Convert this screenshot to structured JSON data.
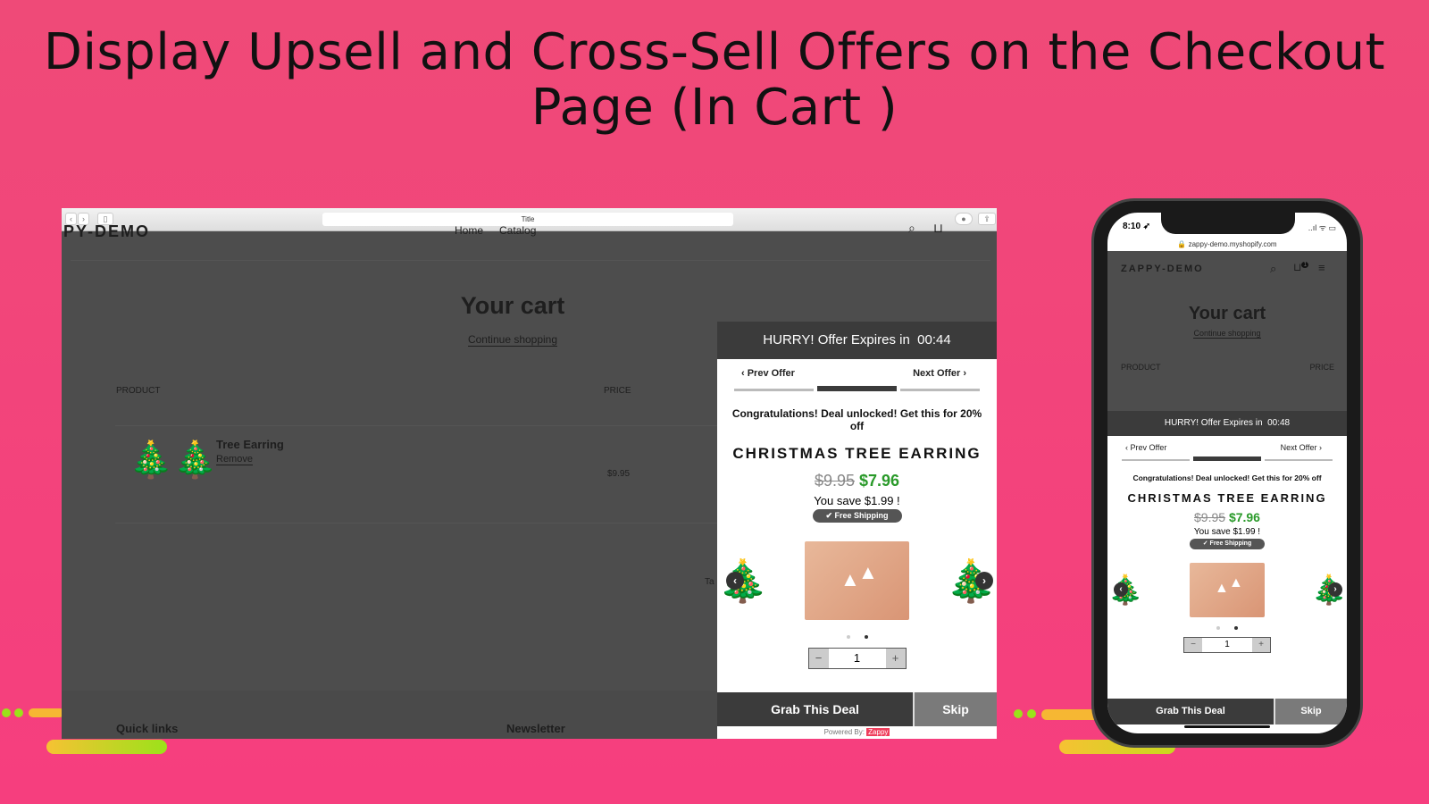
{
  "headline": {
    "line1": "Display Upsell and Cross-Sell Offers on the Checkout",
    "line2": "Page (In Cart )"
  },
  "colors": {
    "background": "#f63e7e",
    "accent_green": "#2a9a2a",
    "dark": "#3b3b3b",
    "brand": "#ef3e5c"
  },
  "desktop": {
    "browser": {
      "title": "Title",
      "back": "‹",
      "forward": "›"
    },
    "store": {
      "logo": "PY-DEMO",
      "nav": [
        "Home",
        "Catalog"
      ],
      "cart_title": "Your cart",
      "continue": "Continue shopping",
      "col_product": "PRODUCT",
      "col_price": "PRICE",
      "item_name": "Tree Earring",
      "remove": "Remove",
      "item_price": "$9.95",
      "footer_left": "Quick links",
      "footer_right": "Newsletter",
      "partial": "Ta"
    },
    "popup": {
      "timer_label": "HURRY! Offer Expires in",
      "timer": "00:44",
      "prev": "‹ Prev Offer",
      "next": "Next Offer ›",
      "congrats": "Congratulations! Deal unlocked! Get this for 20% off",
      "product": "CHRISTMAS TREE EARRING",
      "old_price": "$9.95",
      "new_price": "$7.96",
      "save": "You save $1.99 !",
      "shipping": "✔ Free Shipping",
      "qty": "1",
      "minus": "−",
      "plus": "+",
      "grab": "Grab This Deal",
      "skip": "Skip",
      "powered": "Powered By:",
      "brand": "Zappy"
    }
  },
  "mobile": {
    "status": {
      "time": "8:10 ➶",
      "signals": "..ıl ᯤ ▭"
    },
    "url": "🔒 zappy-demo.myshopify.com",
    "store": {
      "logo": "ZAPPY-DEMO",
      "cart_count": "1",
      "cart_title": "Your cart",
      "continue": "Continue shopping",
      "col_product": "PRODUCT",
      "col_price": "PRICE"
    },
    "popup": {
      "timer_label": "HURRY! Offer Expires in",
      "timer": "00:48",
      "prev": "‹ Prev Offer",
      "next": "Next Offer ›",
      "congrats": "Congratulations! Deal unlocked! Get this for 20% off",
      "product": "CHRISTMAS TREE EARRING",
      "old_price": "$9.95",
      "new_price": "$7.96",
      "save": "You save $1.99 !",
      "shipping": "✓ Free Shipping",
      "qty": "1",
      "minus": "−",
      "plus": "+",
      "grab": "Grab This Deal",
      "skip": "Skip"
    }
  }
}
